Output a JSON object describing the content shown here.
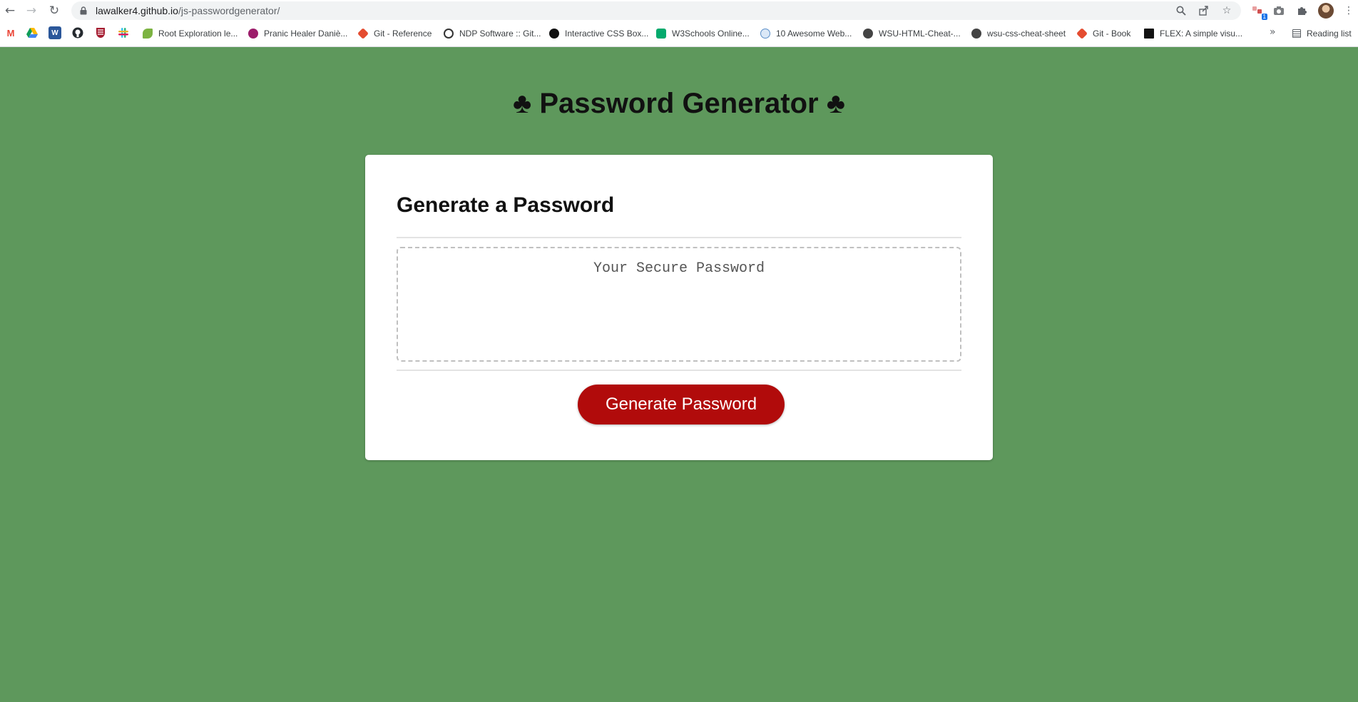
{
  "browser": {
    "url_host": "lawalker4.github.io",
    "url_path": "/js-passwordgenerator/",
    "bookmarks": [
      {
        "label": "Root Exploration le...",
        "color": "#7cb342"
      },
      {
        "label": "Pranic Healer Daniè...",
        "color": "#9c1d6b"
      },
      {
        "label": "Git - Reference",
        "color": "#e44c30"
      },
      {
        "label": "NDP Software :: Git...",
        "color": "#333333"
      },
      {
        "label": "Interactive CSS Box...",
        "color": "#111111"
      },
      {
        "label": "W3Schools Online...",
        "color": "#04aa6d"
      },
      {
        "label": "10 Awesome Web...",
        "color": "#5b8fc9"
      },
      {
        "label": "WSU-HTML-Cheat-...",
        "color": "#444444"
      },
      {
        "label": "wsu-css-cheat-sheet",
        "color": "#444444"
      },
      {
        "label": "Git - Book",
        "color": "#e44c30"
      },
      {
        "label": "FLEX: A simple visu...",
        "color": "#111111"
      }
    ],
    "reading_list": "Reading list",
    "extension_badge": "1"
  },
  "page": {
    "title": "♣ Password Generator ♣",
    "card_header": "Generate a Password",
    "password_placeholder": "Your Secure Password",
    "generate_button": "Generate Password"
  },
  "colors": {
    "background": "#5e985c",
    "button": "#b10b0b"
  }
}
